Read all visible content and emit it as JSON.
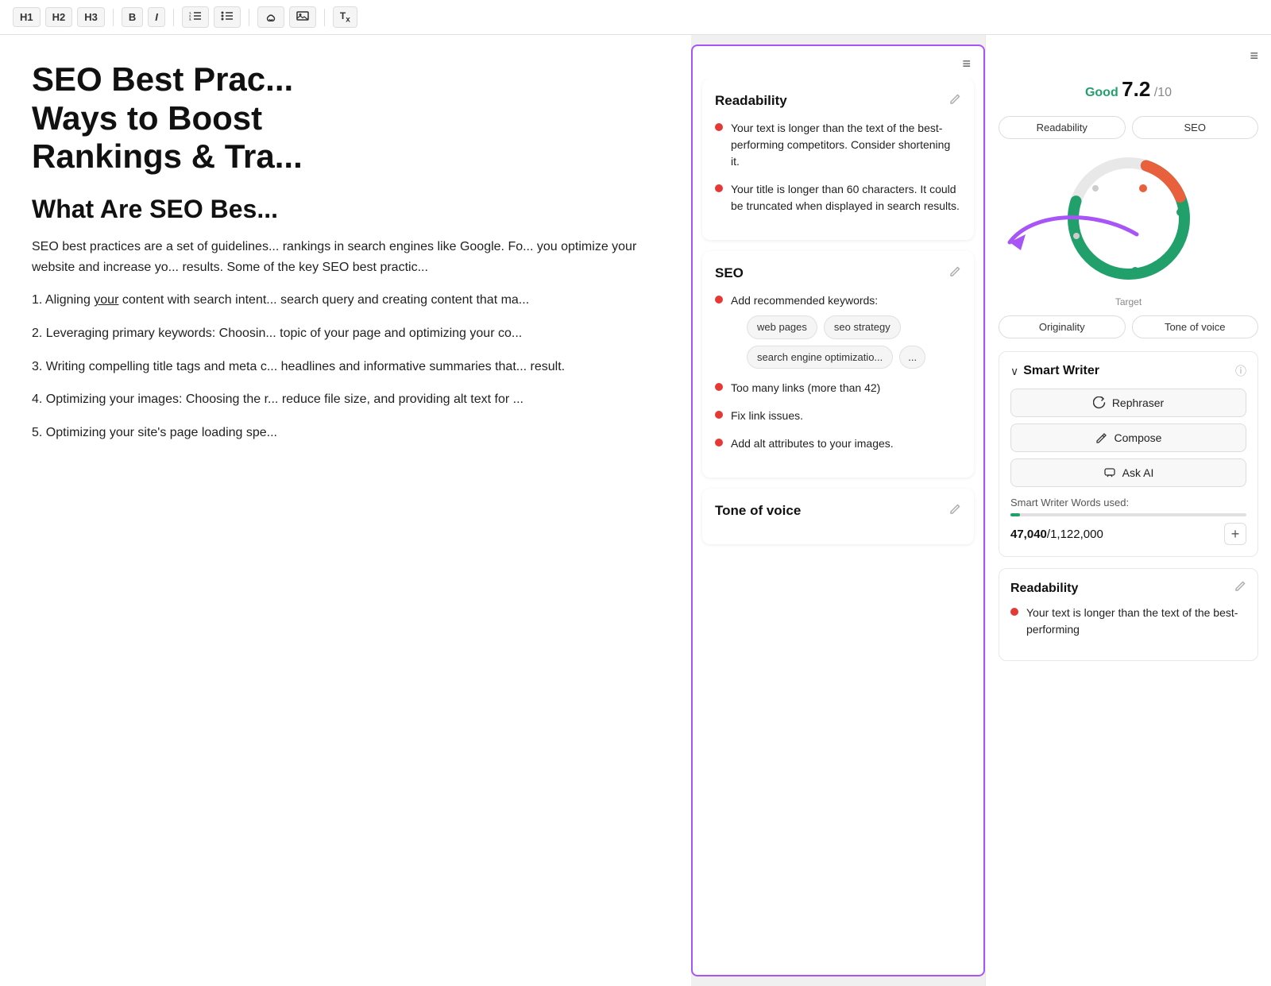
{
  "toolbar": {
    "h1_label": "H1",
    "h2_label": "H2",
    "h3_label": "H3",
    "bold_label": "B",
    "italic_label": "I",
    "ol_label": "≡",
    "ul_label": "≡",
    "link_label": "🔗",
    "image_label": "🖼",
    "clear_label": "Tx"
  },
  "editor": {
    "title": "SEO Best Prac... Ways to Boost Rankings & Tra...",
    "title_full_line1": "SEO Best Prac...",
    "title_full_line2": "Ways to Boost",
    "title_full_line3": "Rankings & Tra...",
    "subtitle": "What Are SEO Bes...",
    "body1": "SEO best practices are a set of guidelines... rankings in search engines like Google. Fo... you optimize your website and increase yo... results. Some of the key SEO best practic...",
    "body2": "1. Aligning your content with search intent... search query and creating content that ma...",
    "body3": "2. Leveraging primary keywords: Choosin... topic of your page and optimizing your co...",
    "body4": "3. Writing compelling title tags and meta c... headlines and informative summaries that... result.",
    "body5": "4. Optimizing your images: Choosing the r... reduce file size, and providing alt text for ...",
    "body6": "5. Optimizing your site's page loading spe..."
  },
  "middle_panel": {
    "menu_icon": "≡",
    "readability": {
      "title": "Readability",
      "bullet1": "Your text is longer than the text of the best-performing competitors. Consider shortening it.",
      "bullet2": "Your title is longer than 60 characters. It could be truncated when displayed in search results."
    },
    "seo": {
      "title": "SEO",
      "bullet_keywords": "Add recommended keywords:",
      "keywords": [
        "web pages",
        "seo strategy",
        "search engine optimizatio...",
        "..."
      ],
      "bullet_links": "Too many links (more than 42)",
      "bullet_fix": "Fix link issues.",
      "bullet_alt": "Add alt attributes to your images."
    },
    "tone": {
      "title": "Tone of voice"
    }
  },
  "right_panel": {
    "menu_icon": "≡",
    "score": {
      "label": "Good",
      "value": "7.2",
      "max": "/10"
    },
    "tabs": {
      "readability": "Readability",
      "seo": "SEO"
    },
    "chart": {
      "target_label": "Target"
    },
    "bottom_tabs": {
      "originality": "Originality",
      "tone_of_voice": "Tone of voice"
    },
    "smart_writer": {
      "title": "Smart Writer",
      "rephraser": "Rephraser",
      "compose": "Compose",
      "ask_ai": "Ask AI",
      "words_used_label": "Smart Writer Words used:",
      "words_count": "47,040",
      "words_max": "1,122,000",
      "progress_percent": 4
    },
    "readability_section": {
      "title": "Readability",
      "bullet1": "Your text is longer than the text of the best-performing"
    }
  },
  "icons": {
    "edit": "✏",
    "rephrase": "↺",
    "compose": "✏",
    "chat": "💬",
    "plus": "+",
    "info": "ⓘ",
    "chevron_down": "∨"
  }
}
